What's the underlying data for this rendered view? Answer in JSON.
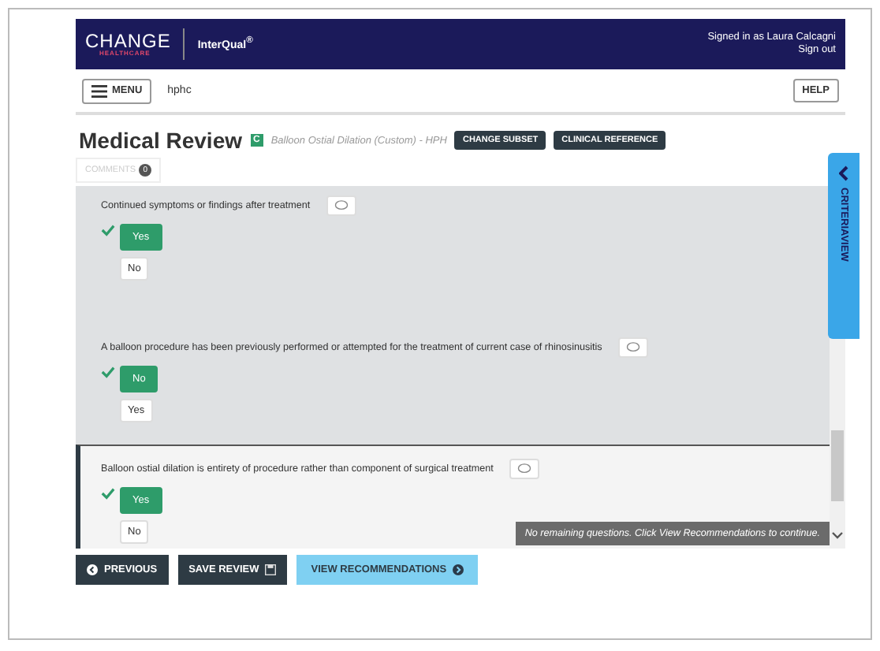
{
  "header": {
    "logo": "CHANGE",
    "logo_sub": "HEALTHCARE",
    "product": "InterQual$^{®}$",
    "signed_in": "Signed in as Laura Calcagni",
    "sign_out": "Sign out"
  },
  "toolbar": {
    "menu": "MENU",
    "org": "hphc",
    "help": "HELP"
  },
  "title": {
    "heading": "Medical Review",
    "badge": "C",
    "subset": "Balloon Ostial Dilation (Custom) - HPH",
    "buttons": [
      "CHANGE SUBSET",
      "CLINICAL REFERENCE"
    ],
    "comments": "COMMENTS",
    "comments_count": "0"
  },
  "criteria_tab": "CRITERIAVIEW",
  "questions": [
    {
      "text": "Continued symptoms or findings after treatment",
      "active": false,
      "answers": [
        {
          "label": "Yes",
          "selected": true
        },
        {
          "label": "No",
          "selected": false
        }
      ]
    },
    {
      "text": "A balloon procedure has been previously performed or attempted for the treatment of current case of rhinosinusitis",
      "active": false,
      "answers": [
        {
          "label": "No",
          "selected": true
        },
        {
          "label": "Yes",
          "selected": false
        }
      ]
    },
    {
      "text": "Balloon ostial dilation is entirety of procedure rather than component of surgical treatment",
      "active": true,
      "answers": [
        {
          "label": "Yes",
          "selected": true
        },
        {
          "label": "No",
          "selected": false
        }
      ]
    }
  ],
  "toast": "No remaining questions. Click View Recommendations to continue.",
  "footer": [
    {
      "label": "PREVIOUS",
      "kind": "previous"
    },
    {
      "label": "SAVE REVIEW",
      "kind": "save"
    },
    {
      "label": "VIEW RECOMMENDATIONS",
      "kind": "next"
    }
  ]
}
